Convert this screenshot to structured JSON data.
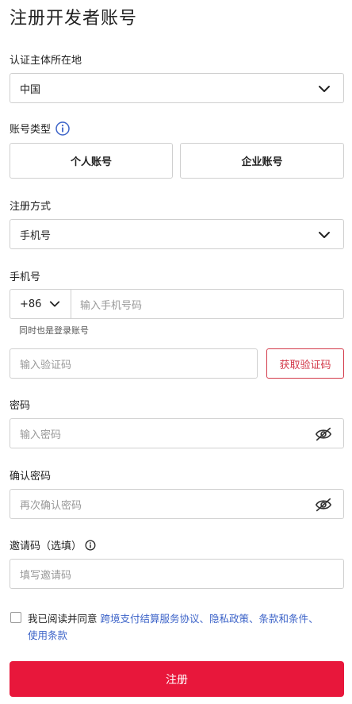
{
  "page": {
    "title": "注册开发者账号"
  },
  "region": {
    "label": "认证主体所在地",
    "value": "中国"
  },
  "account_type": {
    "label": "账号类型",
    "options": [
      "个人账号",
      "企业账号"
    ]
  },
  "method": {
    "label": "注册方式",
    "value": "手机号"
  },
  "phone": {
    "label": "手机号",
    "country_code": "+86",
    "placeholder": "输入手机号码",
    "hint": "同时也是登录账号"
  },
  "verify": {
    "placeholder": "输入验证码",
    "button": "获取验证码"
  },
  "password": {
    "label": "密码",
    "placeholder": "输入密码"
  },
  "confirm": {
    "label": "确认密码",
    "placeholder": "再次确认密码"
  },
  "invite": {
    "label": "邀请码（选填）",
    "placeholder": "填写邀请码"
  },
  "agreement": {
    "prefix": "我已阅读并同意 ",
    "links": [
      "跨境支付结算服务协议",
      "隐私政策",
      "条款和条件",
      "使用条款"
    ],
    "separator": "、"
  },
  "submit": {
    "label": "注册"
  },
  "colors": {
    "accent": "#e8173b",
    "link": "#3c63c8",
    "border": "#cfcfcf"
  }
}
